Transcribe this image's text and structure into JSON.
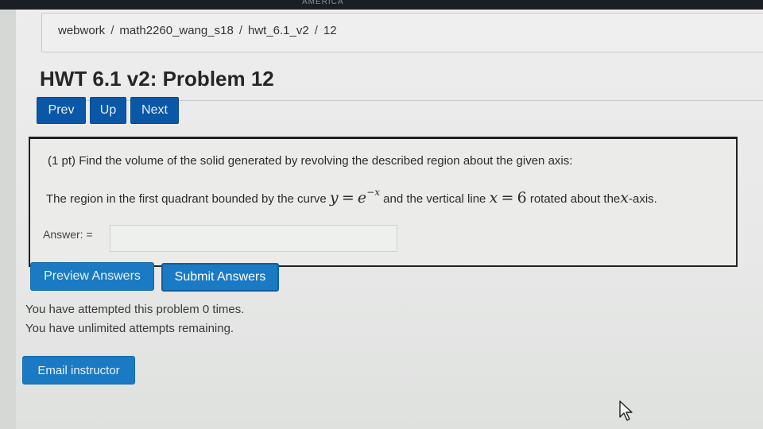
{
  "topbar": {
    "text": "AMERICA"
  },
  "breadcrumb": {
    "items": [
      "webwork",
      "math2260_wang_s18",
      "hwt_6.1_v2",
      "12"
    ],
    "separator": "/"
  },
  "page": {
    "title": "HWT 6.1 v2: Problem 12"
  },
  "nav": {
    "prev": "Prev",
    "up": "Up",
    "next": "Next"
  },
  "problem": {
    "points": "(1 pt)",
    "prompt": "Find the volume of the solid generated by revolving the described region about the given axis:",
    "region_prefix": "The region in the first quadrant bounded by the curve",
    "curve_lhs": "y",
    "curve_eq": "=",
    "curve_base": "e",
    "curve_exp": "−x",
    "region_middle": "and the vertical line",
    "line_var": "x",
    "line_eq": "=",
    "line_value": "6",
    "region_after": "rotated about the",
    "axis_var": "x",
    "axis_suffix": "-axis."
  },
  "answer": {
    "label": "Answer: =",
    "value": ""
  },
  "actions": {
    "preview": "Preview Answers",
    "submit": "Submit Answers"
  },
  "status": {
    "attempts_line": "You have attempted this problem 0 times.",
    "remaining_line": "You have unlimited attempts remaining."
  },
  "footer": {
    "email": "Email instructor"
  },
  "colors": {
    "nav_button": "#0a57a8",
    "action_button": "#1a7ac4",
    "page_background": "#e6e8e6"
  }
}
